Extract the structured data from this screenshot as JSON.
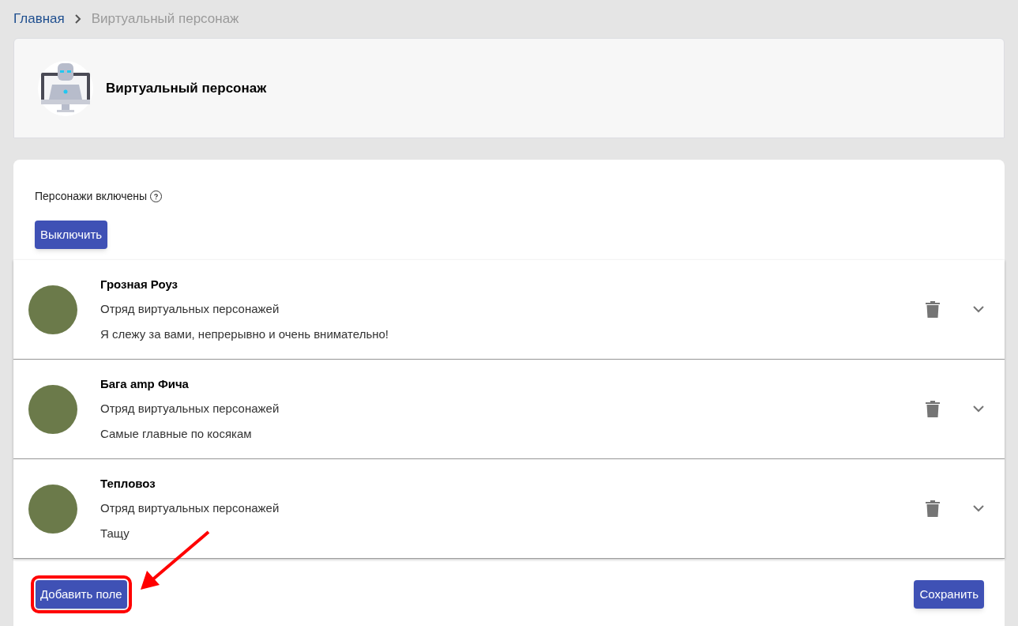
{
  "breadcrumbs": [
    {
      "label": "Главная",
      "selected": false
    },
    {
      "label": "Виртуальный персонаж",
      "selected": true
    }
  ],
  "header": {
    "title": "Виртуальный персонаж"
  },
  "status": {
    "label": "Персонажи включены",
    "button": "Выключить"
  },
  "characters": [
    {
      "name": "Грозная Роуз",
      "group": "Отряд виртуальных персонажей",
      "description": "Я слежу за вами, непрерывно и очень внимательно!"
    },
    {
      "name": "Бага amp Фича",
      "group": "Отряд виртуальных персонажей",
      "description": "Самые главные по косякам"
    },
    {
      "name": "Тепловоз",
      "group": "Отряд виртуальных персонажей",
      "description": "Тащу"
    }
  ],
  "footer": {
    "add_button": "Добавить поле",
    "save_button": "Сохранить"
  }
}
